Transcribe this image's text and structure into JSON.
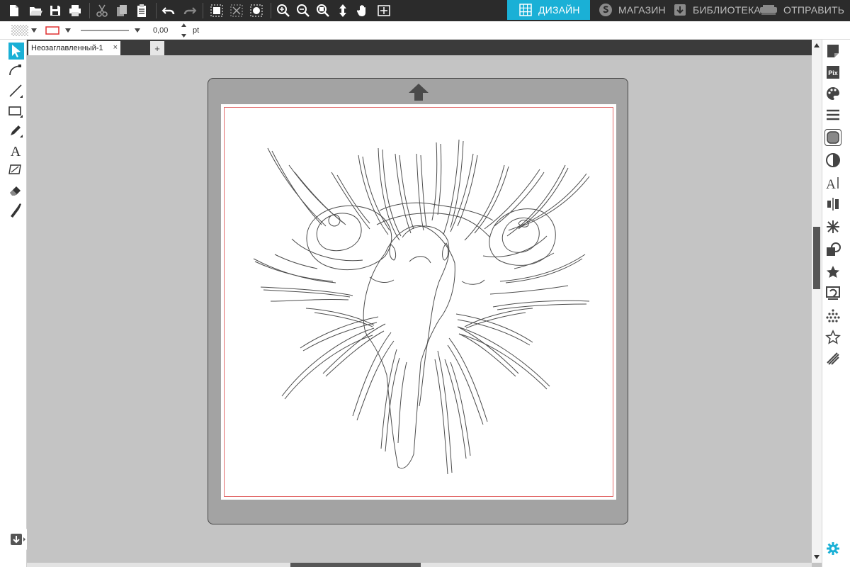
{
  "toolbar": {
    "tabs": {
      "design": "ДИЗАЙН",
      "store": "МАГАЗИН",
      "library": "БИБЛИОТЕКА",
      "send": "ОТПРАВИТЬ"
    },
    "accent": "#1ab0d6"
  },
  "options": {
    "stroke_width": "0,00",
    "unit": "pt",
    "line_color": "#e03030"
  },
  "document": {
    "tab_title": "Неозаглавленный-1",
    "close_glyph": "×",
    "add_glyph": "+"
  }
}
